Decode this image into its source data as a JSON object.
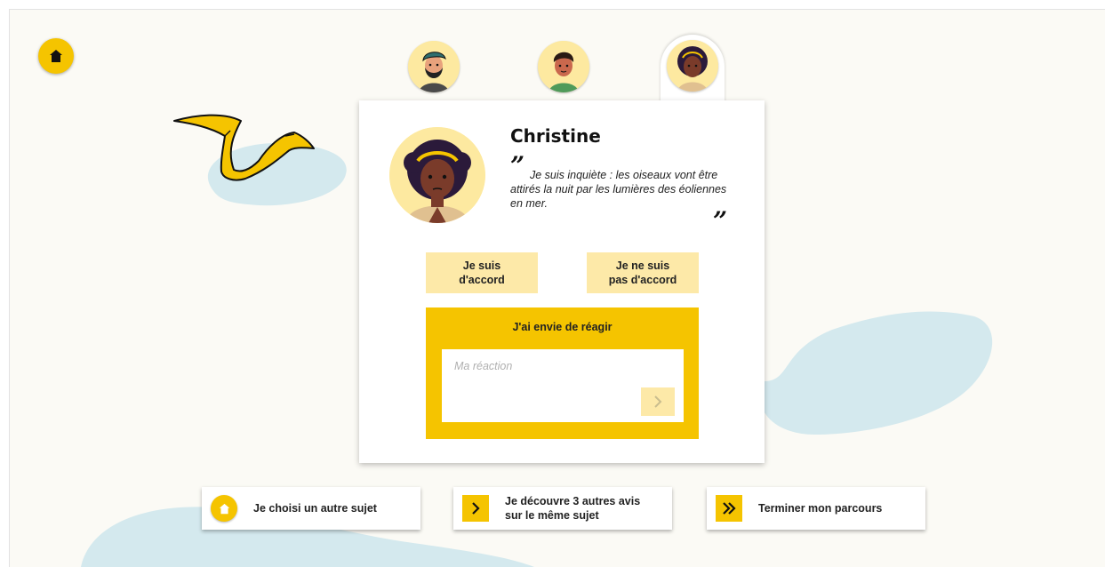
{
  "colors": {
    "accent": "#f5c400",
    "accent_light": "#fde9a8",
    "blob": "#d4e9ee",
    "background": "#fbfaf5"
  },
  "icons": {
    "home": "home-icon",
    "chevron": "chevron-right-icon",
    "double_chevron": "double-chevron-right-icon"
  },
  "characters": [
    {
      "name": "bearded-man",
      "selected": false
    },
    {
      "name": "young-man",
      "selected": false
    },
    {
      "name": "Christine",
      "selected": true
    }
  ],
  "card": {
    "name": "Christine",
    "quote_open": "”",
    "quote": "Je suis inquiète : les oiseaux vont être attirés la nuit par les lumières des éoliennes en mer.",
    "quote_close": "”",
    "agree_label": "Je suis d'accord",
    "disagree_label": "Je ne suis pas d'accord",
    "react_title": "J'ai envie de réagir",
    "reaction_placeholder": "Ma réaction"
  },
  "footer": {
    "other_topic": "Je choisi un autre sujet",
    "discover_more": "Je découvre 3 autres avis sur le même sujet",
    "finish": "Terminer mon parcours"
  }
}
